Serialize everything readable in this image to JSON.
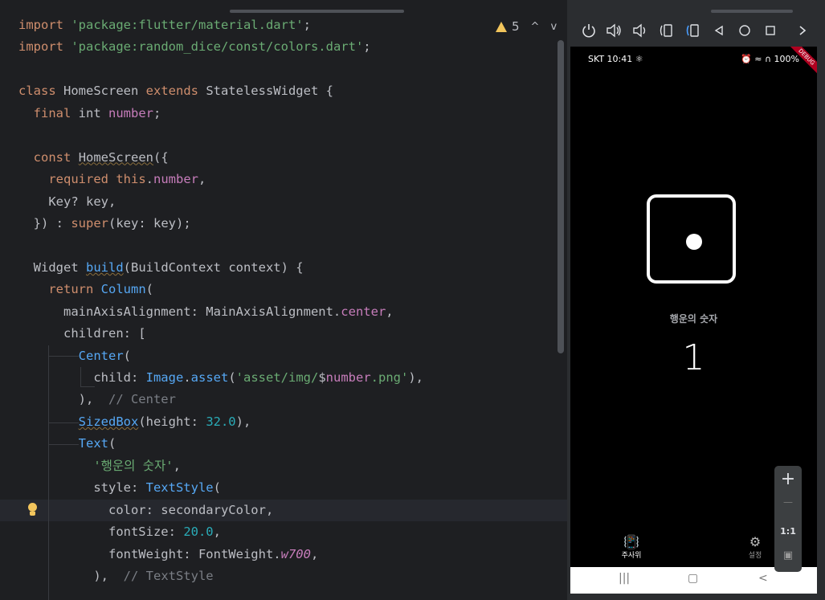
{
  "editor": {
    "warning_count": "5",
    "icons": {
      "warning": "warning-triangle-icon",
      "up": "chevron-up-icon",
      "down": "chevron-down-icon",
      "hint": "lightbulb-icon"
    },
    "lines": [
      [
        [
          "kw",
          "import"
        ],
        [
          "",
          " "
        ],
        [
          "str",
          "'package:flutter/material.dart'"
        ],
        [
          "",
          ";"
        ]
      ],
      [
        [
          "kw",
          "import"
        ],
        [
          "",
          " "
        ],
        [
          "str",
          "'package:random_dice/const/colors.dart'"
        ],
        [
          "",
          ";"
        ]
      ],
      [],
      [
        [
          "kw",
          "class"
        ],
        [
          "",
          " HomeScreen "
        ],
        [
          "kw",
          "extends"
        ],
        [
          "",
          " StatelessWidget {"
        ]
      ],
      [
        [
          "",
          "  "
        ],
        [
          "kw",
          "final"
        ],
        [
          "",
          " int "
        ],
        [
          "fld",
          "number"
        ],
        [
          "",
          ";"
        ]
      ],
      [],
      [
        [
          "",
          "  "
        ],
        [
          "kw",
          "const"
        ],
        [
          "",
          " "
        ],
        [
          "ul",
          "HomeScreen"
        ],
        [
          "",
          "({"
        ]
      ],
      [
        [
          "",
          "    "
        ],
        [
          "kw",
          "required"
        ],
        [
          "",
          " "
        ],
        [
          "kw",
          "this"
        ],
        [
          "",
          "."
        ],
        [
          "fld",
          "number"
        ],
        [
          "",
          ","
        ]
      ],
      [
        [
          "",
          "    Key? key,"
        ]
      ],
      [
        [
          "",
          "  }) : "
        ],
        [
          "kw",
          "super"
        ],
        [
          "",
          "(key: key);"
        ]
      ],
      [],
      [
        [
          "",
          "  Widget "
        ],
        [
          "fn ul",
          "build"
        ],
        [
          "",
          "(BuildContext context) {"
        ]
      ],
      [
        [
          "",
          "    "
        ],
        [
          "kw",
          "return"
        ],
        [
          "",
          " "
        ],
        [
          "fn",
          "Column"
        ],
        [
          "",
          "("
        ]
      ],
      [
        [
          "",
          "      mainAxisAlignment: MainAxisAlignment."
        ],
        [
          "fld",
          "center"
        ],
        [
          "",
          ","
        ]
      ],
      [
        [
          "",
          "      children: ["
        ]
      ],
      [
        [
          "",
          "        "
        ],
        [
          "fn",
          "Center"
        ],
        [
          "",
          "("
        ]
      ],
      [
        [
          "",
          "          child: "
        ],
        [
          "fn",
          "Image"
        ],
        [
          "",
          "."
        ],
        [
          "fn",
          "asset"
        ],
        [
          "",
          "("
        ],
        [
          "str",
          "'asset/img/"
        ],
        [
          "",
          "$"
        ],
        [
          "fld",
          "number"
        ],
        [
          "str",
          ".png'"
        ],
        [
          "",
          "),"
        ]
      ],
      [
        [
          "",
          "        ),  "
        ],
        [
          "cmt",
          "// Center"
        ]
      ],
      [
        [
          "",
          "        "
        ],
        [
          "fn ul",
          "SizedBox"
        ],
        [
          "",
          "(height: "
        ],
        [
          "num",
          "32.0"
        ],
        [
          "",
          "),"
        ]
      ],
      [
        [
          "",
          "        "
        ],
        [
          "fn",
          "Text"
        ],
        [
          "",
          "("
        ]
      ],
      [
        [
          "",
          "          "
        ],
        [
          "str",
          "'행운의 숫자'"
        ],
        [
          "",
          ","
        ]
      ],
      [
        [
          "",
          "          style: "
        ],
        [
          "fn",
          "TextStyle"
        ],
        [
          "",
          "("
        ]
      ],
      [
        [
          "",
          "            color: secondaryColor,"
        ]
      ],
      [
        [
          "",
          "            fontSize: "
        ],
        [
          "num",
          "20.0"
        ],
        [
          "",
          ","
        ]
      ],
      [
        [
          "",
          "            fontWeight: FontWeight."
        ],
        [
          "fld it",
          "w700"
        ],
        [
          "",
          ","
        ]
      ],
      [
        [
          "",
          "          ),  "
        ],
        [
          "cmt",
          "// TextStyle"
        ]
      ]
    ]
  },
  "emulator": {
    "toolbar_icons": [
      "power-icon",
      "volume-up-icon",
      "volume-down-icon",
      "rotate-left-icon",
      "rotate-right-icon",
      "back-icon",
      "home-icon",
      "overview-icon",
      "more-icon"
    ],
    "status": {
      "left": "SKT 10:41",
      "right": "100%"
    },
    "debug_banner": "DEBUG",
    "app": {
      "dice_value": 1,
      "label": "행운의 숫자",
      "number": "1",
      "nav": [
        {
          "label": "주사위",
          "icon": "vibration-icon"
        },
        {
          "label": "설정",
          "icon": "gear-icon"
        }
      ]
    },
    "zoom": {
      "plus": "+",
      "minus": "—",
      "one_to_one": "1:1"
    }
  }
}
